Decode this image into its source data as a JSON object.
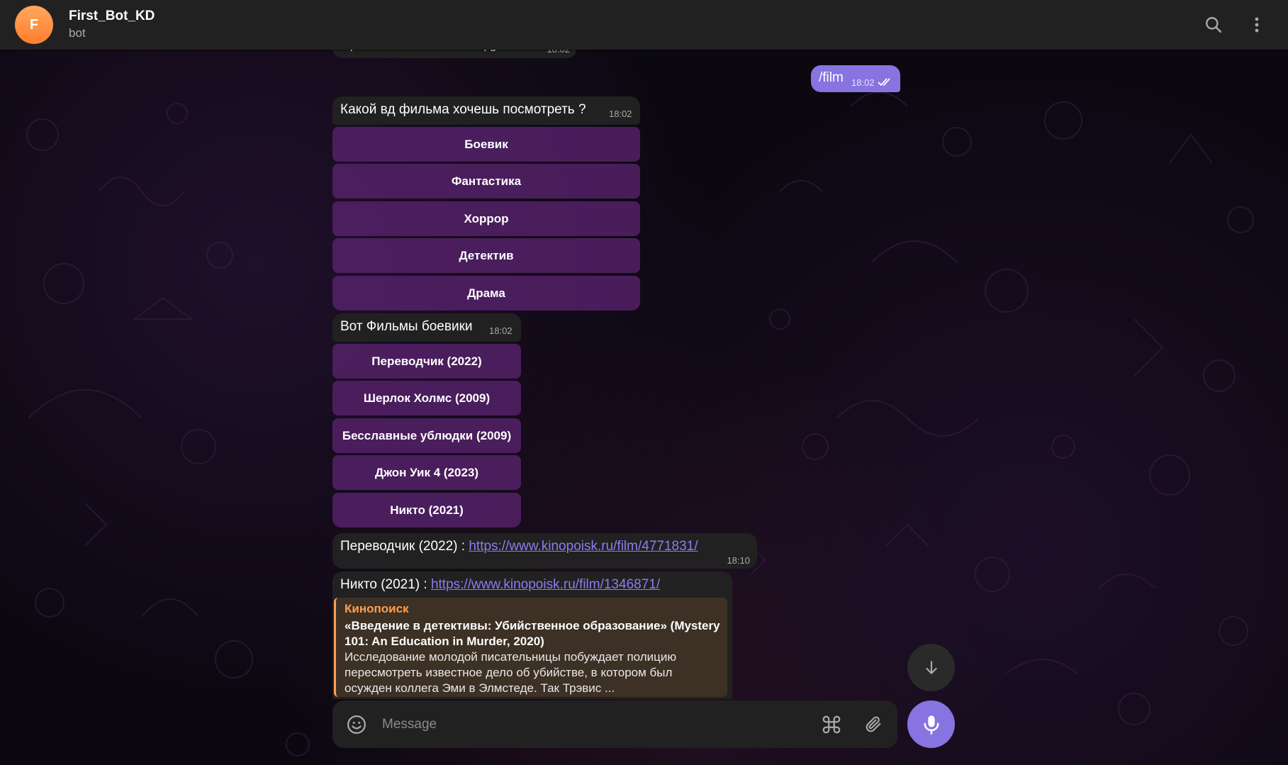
{
  "header": {
    "avatar_letter": "F",
    "title": "First_Bot_KD",
    "subtitle": "bot",
    "icons": [
      "search-icon",
      "more-vertical-icon"
    ]
  },
  "messages": {
    "partial_top": {
      "text": "Привет! Напиши команду /film",
      "time": "18:02"
    },
    "user_film": {
      "text": "/film",
      "time": "18:02",
      "status": "read"
    },
    "genre_question": {
      "text": "Какой вд фильма хочешь посмотреть ?",
      "time": "18:02",
      "buttons": [
        "Боевик",
        "Фантастика",
        "Хоррор",
        "Детектив",
        "Драма"
      ]
    },
    "action_films": {
      "text": "Вот Фильмы боевики",
      "time": "18:02",
      "buttons": [
        "Переводчик (2022)",
        "Шерлок Холмс (2009)",
        "Бесславные ублюдки (2009)",
        "Джон Уик 4 (2023)",
        "Никто (2021)"
      ]
    },
    "link_perevodchik": {
      "prefix": "Переводчик (2022) : ",
      "url": "https://www.kinopoisk.ru/film/4771831/",
      "time": "18:10"
    },
    "link_nikto": {
      "prefix": "Никто (2021) : ",
      "url": "https://www.kinopoisk.ru/film/1346871/",
      "preview": {
        "source": "Кинопоиск",
        "title": "«Введение в детективы: Убийственное образование» (Mystery 101: An Education in Murder, 2020)",
        "description": "Исследование молодой писательницы побуждает полицию пересмотреть известное дело об убийстве, в котором был осужден коллега Эми в Элмстеде. Так Трэвис ..."
      }
    }
  },
  "composer": {
    "placeholder": "Message",
    "icons": [
      "emoji-icon",
      "command-icon",
      "attach-icon",
      "microphone-icon",
      "scroll-down-icon"
    ]
  },
  "colors": {
    "accent": "#8774e1",
    "bubble_in": "#212121",
    "keyboard_button": "#5a236e",
    "link": "#8e7bf0",
    "preview_accent": "#ff9e4f"
  }
}
